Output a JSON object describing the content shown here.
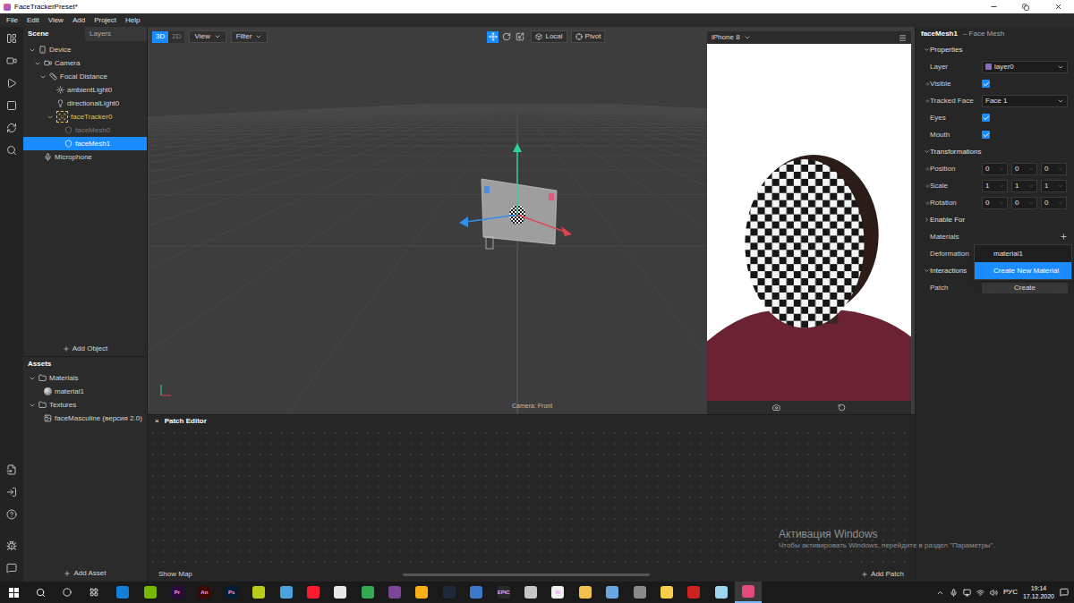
{
  "window": {
    "title": "FaceTrackerPreset*"
  },
  "menu": [
    "File",
    "Edit",
    "View",
    "Add",
    "Project",
    "Help"
  ],
  "scene": {
    "tabs": [
      {
        "label": "Scene",
        "selected": true
      },
      {
        "label": "Layers",
        "selected": false
      }
    ],
    "tree": [
      {
        "label": "Device",
        "kind": "device",
        "depth": 0,
        "has_children": true,
        "expanded": true,
        "selected": false,
        "disabled": false,
        "highlighted": false
      },
      {
        "label": "Camera",
        "kind": "camera",
        "depth": 1,
        "has_children": true,
        "expanded": true,
        "selected": false,
        "disabled": false,
        "highlighted": false
      },
      {
        "label": "Focal Distance",
        "kind": "focal",
        "depth": 2,
        "has_children": true,
        "expanded": true,
        "selected": false,
        "disabled": false,
        "highlighted": false
      },
      {
        "label": "ambientLight0",
        "kind": "ambient",
        "depth": 3,
        "has_children": false,
        "expanded": false,
        "selected": false,
        "disabled": false,
        "highlighted": false
      },
      {
        "label": "directionalLight0",
        "kind": "directional",
        "depth": 3,
        "has_children": false,
        "expanded": false,
        "selected": false,
        "disabled": false,
        "highlighted": false
      },
      {
        "label": "faceTracker0",
        "kind": "tracker",
        "depth": 3,
        "has_children": true,
        "expanded": true,
        "selected": false,
        "disabled": false,
        "highlighted": true
      },
      {
        "label": "faceMesh0",
        "kind": "mesh",
        "depth": 4,
        "has_children": false,
        "expanded": false,
        "selected": false,
        "disabled": true,
        "highlighted": false
      },
      {
        "label": "faceMesh1",
        "kind": "mesh",
        "depth": 4,
        "has_children": false,
        "expanded": false,
        "selected": true,
        "disabled": false,
        "highlighted": false
      },
      {
        "label": "Microphone",
        "kind": "mic",
        "depth": 1,
        "has_children": false,
        "expanded": false,
        "selected": false,
        "disabled": false,
        "highlighted": false
      }
    ],
    "add_label": "Add Object"
  },
  "assets": {
    "title": "Assets",
    "tree": [
      {
        "label": "Materials",
        "kind": "folder",
        "depth": 0,
        "has_children": true,
        "expanded": true,
        "selected": false,
        "disabled": false,
        "highlighted": false
      },
      {
        "label": "material1",
        "kind": "material",
        "depth": 1,
        "has_children": false,
        "expanded": false,
        "selected": false,
        "disabled": false,
        "highlighted": false
      },
      {
        "label": "Textures",
        "kind": "folder",
        "depth": 0,
        "has_children": true,
        "expanded": true,
        "selected": false,
        "disabled": false,
        "highlighted": false
      },
      {
        "label": "faceMasculine (версия 2.0)",
        "kind": "texture",
        "depth": 1,
        "has_children": false,
        "expanded": false,
        "selected": false,
        "disabled": false,
        "highlighted": false
      }
    ],
    "add_label": "Add Asset"
  },
  "viewport": {
    "modes": [
      {
        "label": "3D",
        "selected": true
      },
      {
        "label": "2D",
        "selected": false
      }
    ],
    "menus": [
      "View",
      "Filter"
    ],
    "tools": [
      {
        "kind": "move",
        "selected": true
      },
      {
        "kind": "rotate",
        "selected": false
      },
      {
        "kind": "scale",
        "selected": false
      }
    ],
    "space": "Local",
    "pivot": "Pivot",
    "camera_label": "Camera: Front"
  },
  "simulator": {
    "device": "iPhone 8"
  },
  "patch_editor": {
    "close": "×",
    "title": "Patch Editor",
    "show_map": "Show Map",
    "add_label": "Add Patch"
  },
  "inspector": {
    "name": "faceMesh1",
    "type": "– Face Mesh",
    "rows": [
      {
        "kind": "section",
        "label": "Properties",
        "expanded": true,
        "linkable": false
      },
      {
        "kind": "select",
        "label": "Layer",
        "value": "layer0",
        "color": "#8a6bbf",
        "linkable": false
      },
      {
        "kind": "checkbox",
        "label": "Visible",
        "checked": true,
        "linkable": true
      },
      {
        "kind": "select",
        "label": "Tracked Face",
        "value": "Face 1",
        "linkable": true
      },
      {
        "kind": "checkbox",
        "label": "Eyes",
        "checked": true,
        "linkable": false
      },
      {
        "kind": "checkbox",
        "label": "Mouth",
        "checked": true,
        "linkable": false
      },
      {
        "kind": "section",
        "label": "Transformations",
        "expanded": true,
        "linkable": false
      },
      {
        "kind": "vector",
        "label": "Position",
        "values": [
          "0",
          "0",
          "0"
        ],
        "linkable": true
      },
      {
        "kind": "vector",
        "label": "Scale",
        "values": [
          "1",
          "1",
          "1"
        ],
        "linkable": true
      },
      {
        "kind": "vector",
        "label": "Rotation",
        "values": [
          "0",
          "0",
          "0"
        ],
        "linkable": true
      },
      {
        "kind": "section",
        "label": "Enable For",
        "expanded": false,
        "linkable": false
      },
      {
        "kind": "add",
        "label": "Materials",
        "linkable": false
      },
      {
        "kind": "label",
        "label": "Deformation",
        "linkable": false
      },
      {
        "kind": "section",
        "label": "Interactions",
        "expanded": true,
        "linkable": false
      },
      {
        "kind": "button",
        "label": "Patch",
        "value": "Create",
        "linkable": false
      }
    ],
    "dropdown": [
      {
        "label": "material1",
        "selected": false
      },
      {
        "label": "Create New Material",
        "selected": true
      }
    ]
  },
  "watermark": {
    "title": "Активация Windows",
    "text": "Чтобы активировать Windows, перейдите в раздел \"Параметры\"."
  },
  "taskbar": {
    "apps": [
      {
        "color": "#1380d8",
        "label": "",
        "active": false
      },
      {
        "color": "#76b900",
        "label": "",
        "active": false
      },
      {
        "color": "#2a0a3a",
        "label": "Pr",
        "active": false
      },
      {
        "color": "#3a0a00",
        "label": "An",
        "active": false
      },
      {
        "color": "#001e36",
        "label": "Ps",
        "active": false
      },
      {
        "color": "#b8cc1a",
        "label": "",
        "active": false
      },
      {
        "color": "#4aa3df",
        "label": "",
        "active": false
      },
      {
        "color": "#ff1b2d",
        "label": "",
        "active": false
      },
      {
        "color": "#e8e8e8",
        "label": "",
        "active": false
      },
      {
        "color": "#34a853",
        "label": "",
        "active": false
      },
      {
        "color": "#7d4698",
        "label": "",
        "active": false
      },
      {
        "color": "#fcaf17",
        "label": "",
        "active": false
      },
      {
        "color": "#1b2838",
        "label": "",
        "active": false
      },
      {
        "color": "#3b79c9",
        "label": "",
        "active": false
      },
      {
        "color": "#2a2a2a",
        "label": "EPIC",
        "active": false
      },
      {
        "color": "#c7c7c7",
        "label": "",
        "active": false
      },
      {
        "color": "#f0f0f0",
        "label": "W",
        "active": false
      },
      {
        "color": "#f2c14e",
        "label": "",
        "active": false
      },
      {
        "color": "#6aa6e0",
        "label": "",
        "active": false
      },
      {
        "color": "#8a8a8a",
        "label": "",
        "active": false
      },
      {
        "color": "#f7d04a",
        "label": "",
        "active": false
      },
      {
        "color": "#cc2222",
        "label": "",
        "active": false
      },
      {
        "color": "#9fd4f0",
        "label": "",
        "active": false
      },
      {
        "color": "#e34b7a",
        "label": "",
        "active": true
      }
    ],
    "language": "РУС",
    "time": "19:14",
    "date": "17.12.2020"
  }
}
